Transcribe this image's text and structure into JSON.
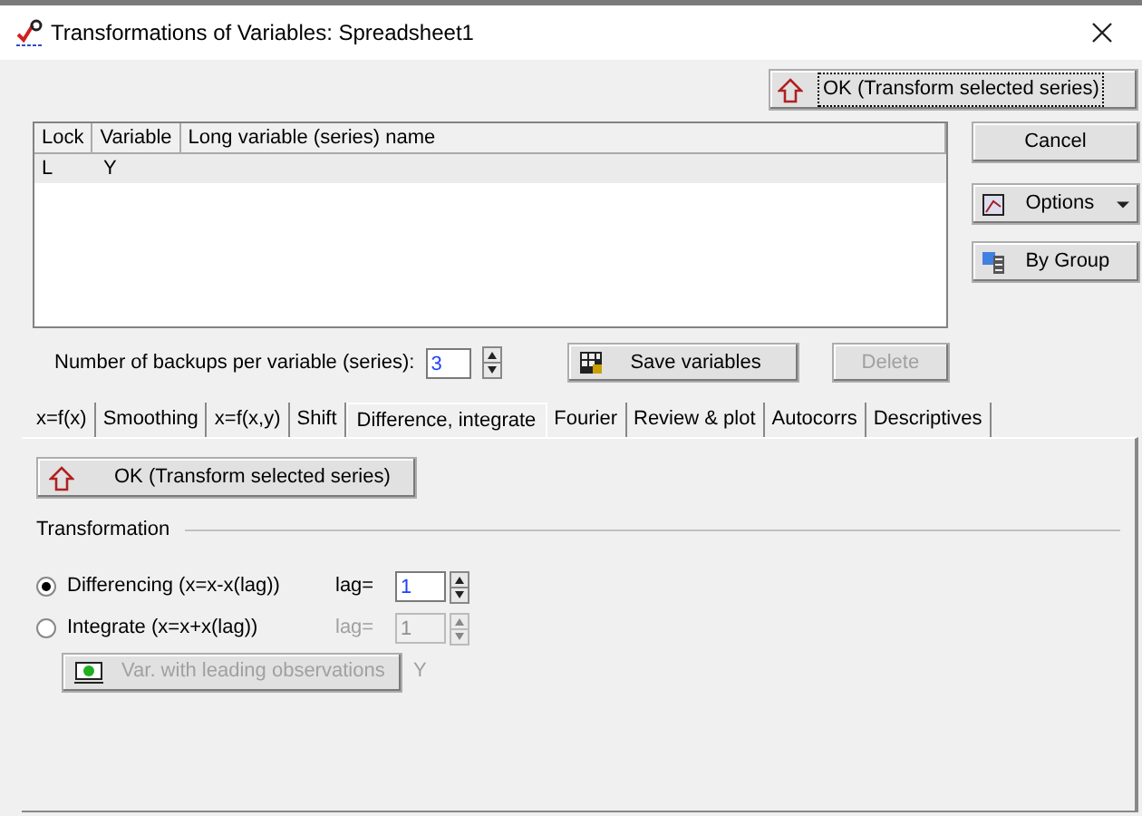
{
  "window": {
    "title": "Transformations of Variables: Spreadsheet1"
  },
  "top_button": {
    "label": "OK (Transform selected series)"
  },
  "table": {
    "columns": [
      "Lock",
      "Variable",
      "Long variable (series) name"
    ],
    "rows": [
      {
        "cells": [
          "L",
          "Y",
          ""
        ],
        "selected": true
      }
    ]
  },
  "side_buttons": [
    {
      "label": "Cancel",
      "kind": "plain"
    },
    {
      "label": "Options",
      "kind": "options"
    },
    {
      "label": "By Group",
      "kind": "group"
    }
  ],
  "backups": {
    "label": "Number of backups per variable (series):",
    "value": "3"
  },
  "save_button": {
    "label": "Save variables"
  },
  "delete_button": {
    "label": "Delete",
    "disabled": true
  },
  "tabs": [
    {
      "label": "x=f(x)",
      "selected": false
    },
    {
      "label": "Smoothing",
      "selected": false
    },
    {
      "label": "x=f(x,y)",
      "selected": false
    },
    {
      "label": "Shift",
      "selected": false
    },
    {
      "label": "Difference, integrate",
      "selected": true
    },
    {
      "label": "Fourier",
      "selected": false
    },
    {
      "label": "Review & plot",
      "selected": false
    },
    {
      "label": "Autocorrs",
      "selected": false
    },
    {
      "label": "Descriptives",
      "selected": false
    }
  ],
  "panel": {
    "ok_button": {
      "label": "OK (Transform selected series)"
    },
    "group_title": "Transformation",
    "options": [
      {
        "label": "Differencing (x=x-x(lag))",
        "selected": true,
        "lag_label": "lag=",
        "lag": "1",
        "disabled": false
      },
      {
        "label": "Integrate (x=x+x(lag))",
        "selected": false,
        "lag_label": "lag=",
        "lag": "1",
        "disabled": true
      }
    ],
    "leading_button": {
      "label": "Var. with leading observations",
      "disabled": true
    },
    "leading_value": "Y"
  }
}
